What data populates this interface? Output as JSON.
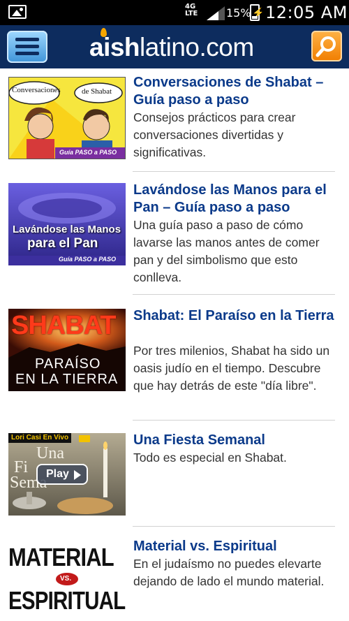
{
  "status_bar": {
    "network": "4G LTE",
    "battery_percent": "15%",
    "time": "12:05 AM"
  },
  "header": {
    "logo_bold": "aish",
    "logo_rest": "latino.com",
    "menu_icon": "hamburger-menu-icon",
    "search_icon": "search-icon",
    "accent_color": "#0d2c5e",
    "search_color": "#f07d00"
  },
  "articles": [
    {
      "title": "Conversaciones de Shabat – Guía paso a paso",
      "description": "Consejos prácticos para crear conversaciones divertidas y significativas.",
      "thumb": {
        "bubble1": "Conversaciones",
        "bubble2": "de Shabat",
        "banner": "Guía PASO a PASO"
      }
    },
    {
      "title": "Lavándose las Manos para el Pan – Guía paso a paso",
      "description": "Una guía paso a paso de cómo lavarse las manos antes de comer pan y del simbolismo que esto conlleva.",
      "thumb": {
        "line1": "Lavándose las Manos",
        "line2": "para el Pan",
        "banner": "Guía PASO a PASO"
      }
    },
    {
      "title": "Shabat: El Paraíso en la Tierra",
      "description": "Por tres milenios, Shabat ha sido un oasis judío en el tiempo. Descubre que hay detrás de este \"día libre\".",
      "thumb": {
        "line1": "SHABAT",
        "line2": "PARAÍSO",
        "line3": "EN LA TIERRA"
      }
    },
    {
      "title": "Una Fiesta Semanal",
      "description": "Todo es especial en Shabat.",
      "thumb": {
        "badge": "Lori Casi En Vivo",
        "overlay1": "Una",
        "overlay2": "Fi",
        "overlay3": "Sema",
        "play": "Play"
      }
    },
    {
      "title": "Material vs. Espiritual",
      "description": "En el judaísmo no puedes elevarte dejando de lado el mundo material.",
      "thumb": {
        "line1": "MATERIAL",
        "vs": "VS.",
        "line2": "ESPIRITUAL"
      }
    }
  ]
}
